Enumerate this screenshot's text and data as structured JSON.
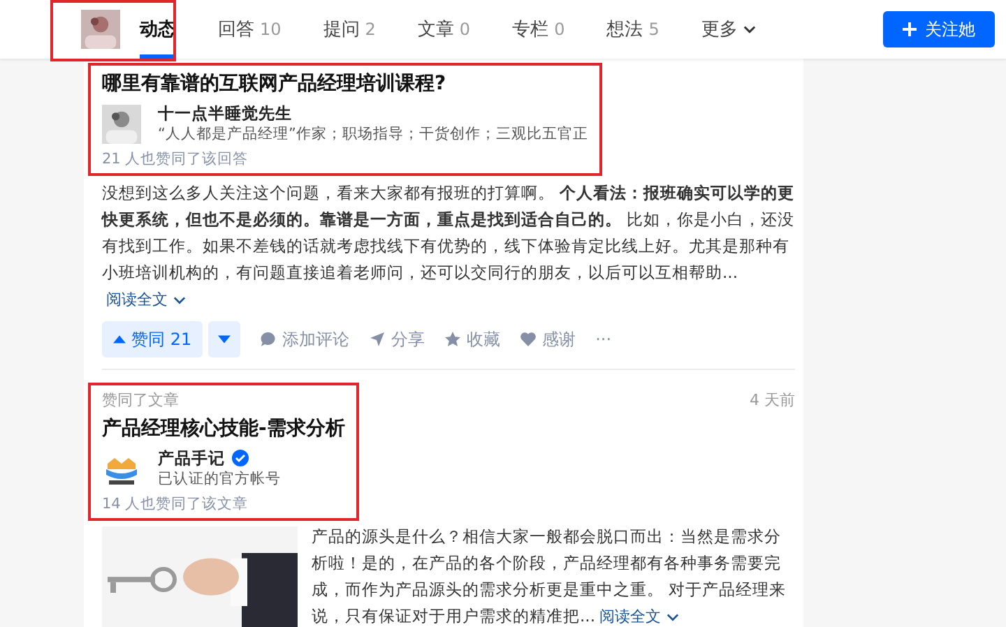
{
  "nav": {
    "tabs": [
      {
        "label": "动态",
        "selected": true
      },
      {
        "label": "回答",
        "count": "10",
        "selected": false
      },
      {
        "label": "提问",
        "count": "2",
        "selected": false
      },
      {
        "label": "文章",
        "count": "0",
        "selected": false
      },
      {
        "label": "专栏",
        "count": "0",
        "selected": false
      },
      {
        "label": "想法",
        "count": "5",
        "selected": false
      }
    ],
    "more": "更多",
    "follow_button": "关注她"
  },
  "feed": [
    {
      "kind": "answer",
      "title": "哪里有靠谱的互联网产品经理培训课程?",
      "author": {
        "name": "十一点半睡觉先生",
        "bio": "“人人都是产品经理”作家；职场指导；干货创作；三观比五官正"
      },
      "agree_note": "21 人也赞同了该回答",
      "excerpt": "没想到这么多人关注这个问题，看来大家都有报班的打算啊。 **个人看法：报班确实可以学的更快更系统，但也不是必须的。靠谱是一方面，重点是找到适合自己的。** 比如，你是小白，还没有找到工作。如果不差钱的话就考虑找线下有优势的，线下体验肯定比线上好。尤其是那种有小班培训机构的，有问题直接追着老师问，还可以交同行的朋友，以后可以互相帮助...",
      "read_more": "阅读全文",
      "actions": {
        "vote": "赞同 21",
        "comment": "添加评论",
        "share": "分享",
        "collect": "收藏",
        "thank": "感谢",
        "more": "···"
      }
    },
    {
      "kind": "article",
      "activity": "赞同了文章",
      "time": "4 天前",
      "title": "产品经理核心技能-需求分析",
      "author": {
        "name": "产品手记",
        "bio": "已认证的官方帐号",
        "verified": true
      },
      "agree_note": "14 人也赞同了该文章",
      "excerpt": "产品的源头是什么？相信大家一般都会脱口而出：当然是需求分析啦！是的，在产品的各个阶段，产品经理都有各种事务需要完成，而作为产品源头的需求分析更是重中之重。 对于产品经理来说，只有保证对于用户需求的精准把...",
      "read_more": "阅读全文"
    }
  ]
}
